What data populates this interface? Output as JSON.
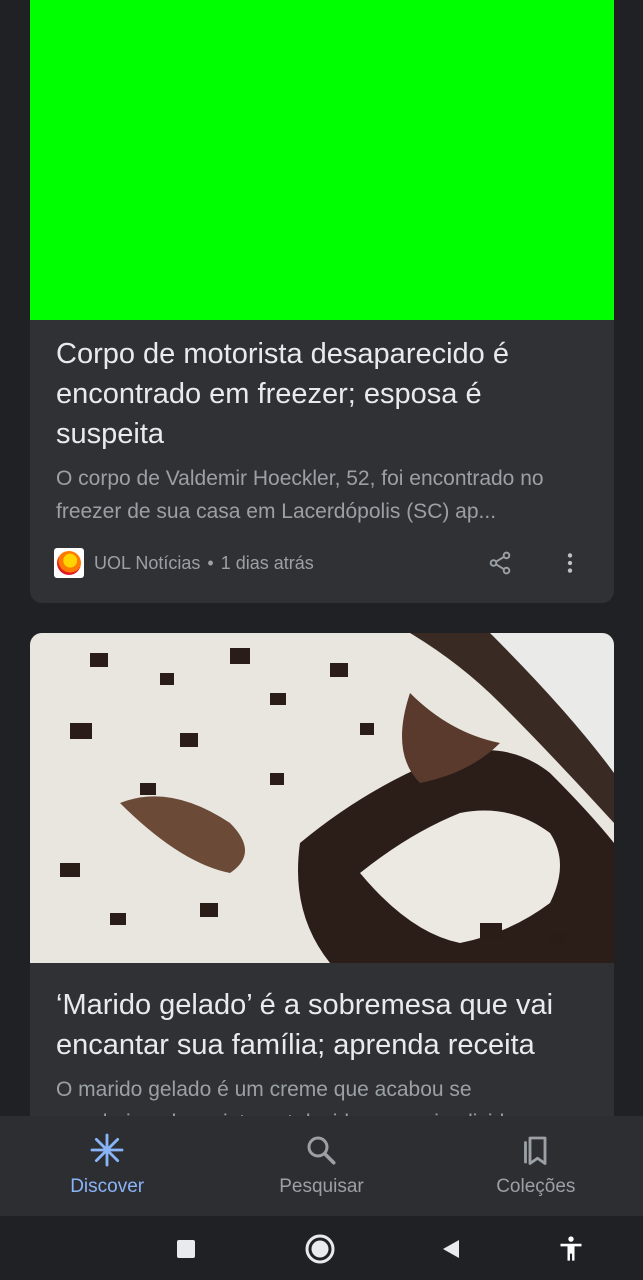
{
  "feed": {
    "cards": [
      {
        "title": "Corpo de motorista desaparecido é encontrado em freezer; esposa é suspeita",
        "snippet": "O corpo de Valdemir Hoeckler, 52, foi encontrado no freezer de sua casa em Lacerdópolis (SC) ap...",
        "source": "UOL Notícias",
        "separator": "•",
        "time": "1 dias atrás",
        "image_color": "#00ff00"
      },
      {
        "title": "‘Marido gelado’ é a sobremesa que vai encantar sua família; aprenda receita",
        "snippet": "O marido gelado é um creme que acabou se popularizando na internet devido a sua simplicid"
      }
    ]
  },
  "bottom_nav": {
    "items": [
      {
        "label": "Discover",
        "icon": "discover-asterisk-icon",
        "active": true
      },
      {
        "label": "Pesquisar",
        "icon": "search-icon",
        "active": false
      },
      {
        "label": "Coleções",
        "icon": "collections-bookmark-icon",
        "active": false
      }
    ]
  },
  "system_nav": {
    "buttons": [
      "recents-square-icon",
      "home-circle-icon",
      "back-triangle-icon",
      "accessibility-icon"
    ]
  },
  "colors": {
    "background": "#202124",
    "card": "#303134",
    "accent": "#8ab4f8",
    "secondary_text": "#9aa0a6"
  }
}
